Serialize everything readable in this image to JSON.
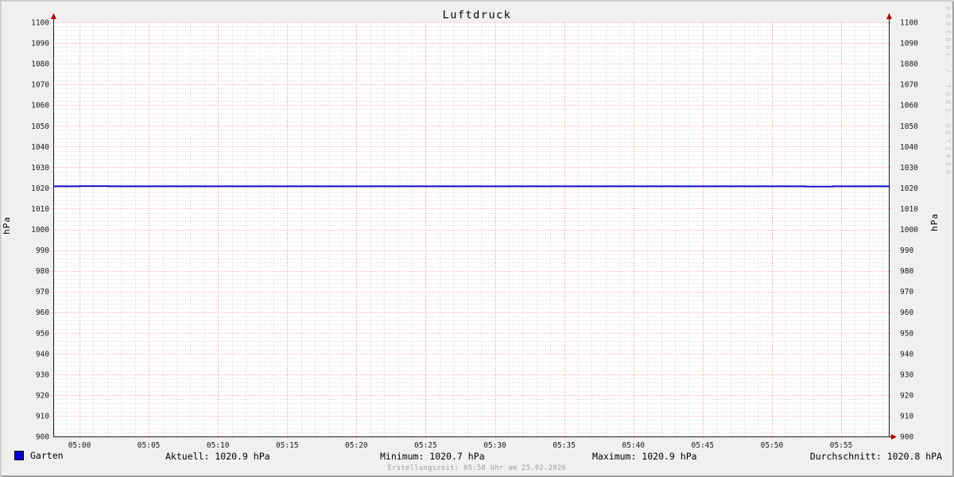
{
  "chart_data": {
    "type": "line",
    "title": "Luftdruck",
    "ylabel_left": "hPa",
    "ylabel_right": "hPa",
    "xlabel": "",
    "ylim": [
      900,
      1100
    ],
    "y_major_step": 10,
    "y_minor_step": 2,
    "y_ticks": [
      900,
      910,
      920,
      930,
      940,
      950,
      960,
      970,
      980,
      990,
      1000,
      1010,
      1020,
      1030,
      1040,
      1050,
      1060,
      1070,
      1080,
      1090,
      1100
    ],
    "x_ticks": [
      "05:00",
      "05:05",
      "05:10",
      "05:15",
      "05:20",
      "05:25",
      "05:30",
      "05:35",
      "05:40",
      "05:45",
      "05:50",
      "05:55"
    ],
    "x_major_step_minutes": 5,
    "x_minor_step_minutes": 1,
    "x_range_minutes_rel_0500": [
      -1.9,
      58.45
    ],
    "grid": true,
    "legend_position": "bottom",
    "series": [
      {
        "name": "Garten",
        "color": "#0000cc",
        "x_unit": "minutes after 05:00",
        "points": [
          [
            -1.9,
            1020.8
          ],
          [
            0,
            1020.8
          ],
          [
            0,
            1020.9
          ],
          [
            2.1,
            1020.9
          ],
          [
            2.1,
            1020.8
          ],
          [
            52.4,
            1020.8
          ],
          [
            52.4,
            1020.7
          ],
          [
            54.4,
            1020.7
          ],
          [
            54.4,
            1020.8
          ],
          [
            58.45,
            1020.8
          ]
        ]
      }
    ],
    "colors": {
      "background": "#f0f0f0",
      "canvas": "#ffffff",
      "grid_major": "#f09090",
      "grid_minor": "#d8d8d8",
      "axis": "#1a1a1a",
      "arrow": "#aa0000",
      "line": "#0000cc"
    }
  },
  "legend": {
    "series_label": "Garten",
    "stats": [
      "Aktuell: 1020.9 hPa",
      "Minimum: 1020.7 hPa",
      "Maximum: 1020.9 hPa",
      "Durchschnitt: 1020.8 hPA"
    ]
  },
  "footer": {
    "text": "Erstellungszeit: 05:58 Uhr am 25.02.2026"
  },
  "watermark": {
    "text": "RRDTOOL / TOBI OETIKER"
  }
}
